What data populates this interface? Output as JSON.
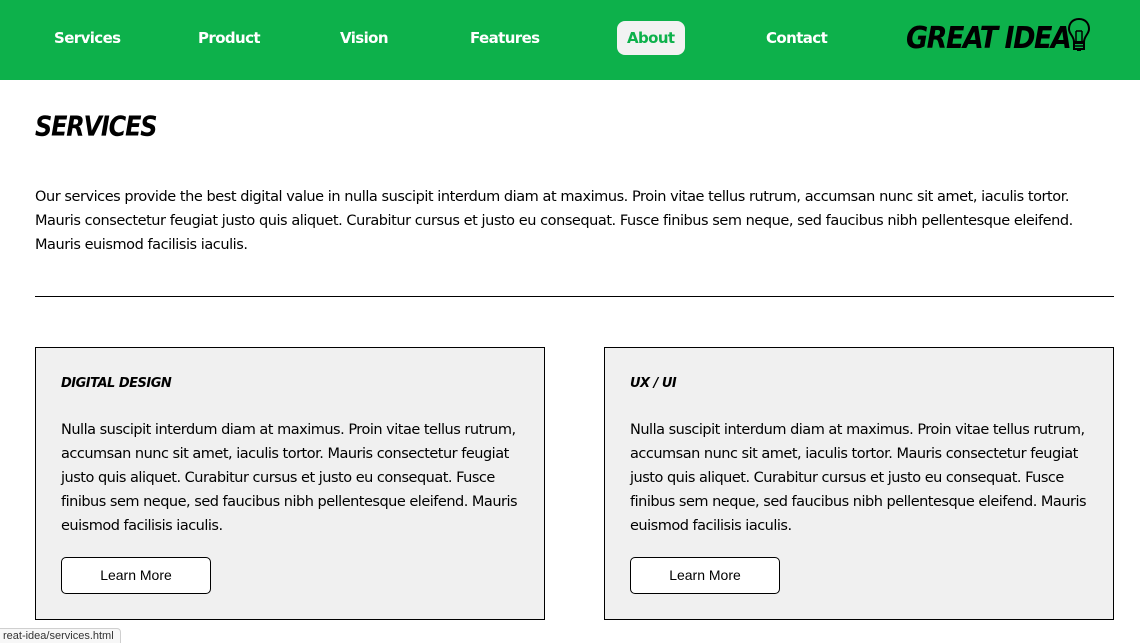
{
  "nav": {
    "items": [
      {
        "label": "Services"
      },
      {
        "label": "Product"
      },
      {
        "label": "Vision"
      },
      {
        "label": "Features"
      },
      {
        "label": "About",
        "active": true
      },
      {
        "label": "Contact"
      }
    ],
    "logo_text": "GREAT IDEA",
    "logo_icon": "lightbulb-icon"
  },
  "colors": {
    "brand_green": "#0db14b",
    "active_tab_bg": "#f2f2f2",
    "card_bg": "#f0f0f0",
    "text": "#000000"
  },
  "main": {
    "title": "SERVICES",
    "intro": "Our services provide the best digital value in nulla suscipit interdum diam at maximus. Proin vitae tellus rutrum, accumsan nunc sit amet, iaculis tortor. Mauris consectetur feugiat justo quis aliquet. Curabitur cursus et justo eu consequat. Fusce finibus sem neque, sed faucibus nibh pellentesque eleifend. Mauris euismod facilisis iaculis.",
    "cards": [
      {
        "title": "Digital Design",
        "text": "Nulla suscipit interdum diam at maximus. Proin vitae tellus rutrum, accumsan nunc sit amet, iaculis tortor. Mauris consectetur feugiat justo quis aliquet. Curabitur cursus et justo eu consequat. Fusce finibus sem neque, sed faucibus nibh pellentesque eleifend. Mauris euismod facilisis iaculis.",
        "button": "Learn More"
      },
      {
        "title": "UX / UI",
        "text": "Nulla suscipit interdum diam at maximus. Proin vitae tellus rutrum, accumsan nunc sit amet, iaculis tortor. Mauris consectetur feugiat justo quis aliquet. Curabitur cursus et justo eu consequat. Fusce finibus sem neque, sed faucibus nibh pellentesque eleifend. Mauris euismod facilisis iaculis.",
        "button": "Learn More"
      }
    ]
  },
  "status_bar": {
    "url": "reat-idea/services.html"
  }
}
